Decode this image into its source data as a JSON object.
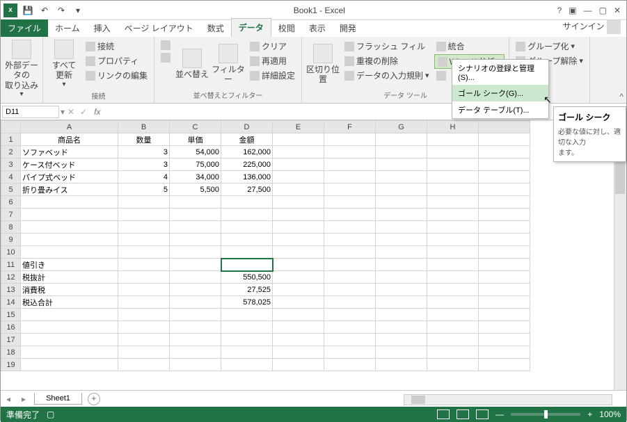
{
  "app": {
    "title": "Book1 - Excel",
    "signin": "サインイン"
  },
  "tabs": {
    "file": "ファイル",
    "home": "ホーム",
    "insert": "挿入",
    "pagelayout": "ページ レイアウト",
    "formulas": "数式",
    "data": "データ",
    "review": "校閲",
    "view": "表示",
    "dev": "開発"
  },
  "ribbon": {
    "ext_data": "外部データの\n取り込み",
    "refresh": "すべて\n更新",
    "conn_label": "接続",
    "conn": "接続",
    "prop": "プロパティ",
    "editlink": "リンクの編集",
    "sortasc": "A→Z",
    "sortdesc": "Z→A",
    "sort": "並べ替え",
    "filter": "フィルター",
    "clear": "クリア",
    "reapply": "再適用",
    "advanced": "詳細設定",
    "sortfilter_label": "並べ替えとフィルター",
    "t2c": "区切り位置",
    "flash": "フラッシュ フィル",
    "dedup": "重複の削除",
    "dataval": "データの入力規則",
    "consol": "統合",
    "whatif": "What-If 分析",
    "datatools_label": "データ ツール",
    "group": "グループ化",
    "ungroup": "グループ解除"
  },
  "whatif_menu": {
    "scenario": "シナリオの登録と管理(S)...",
    "goal": "ゴール シーク(G)...",
    "table": "データ テーブル(T)..."
  },
  "tooltip": {
    "title": "ゴール シーク",
    "body": "必要な値に対し、適切な入力\nます。"
  },
  "namebox": "D11",
  "cols": [
    "A",
    "B",
    "C",
    "D",
    "E",
    "F",
    "G",
    "H"
  ],
  "rows": [
    {
      "r": 1,
      "a": "商品名",
      "b": "数量",
      "c": "単価",
      "d": "金額",
      "hdr": true
    },
    {
      "r": 2,
      "a": "ソファベッド",
      "b": "3",
      "c": "54,000",
      "d": "162,000"
    },
    {
      "r": 3,
      "a": "ケース付ベッド",
      "b": "3",
      "c": "75,000",
      "d": "225,000"
    },
    {
      "r": 4,
      "a": "パイプ式ベッド",
      "b": "4",
      "c": "34,000",
      "d": "136,000"
    },
    {
      "r": 5,
      "a": "折り畳みイス",
      "b": "5",
      "c": "5,500",
      "d": "27,500"
    },
    {
      "r": 6,
      "a": "",
      "b": "",
      "c": "",
      "d": ""
    },
    {
      "r": 7,
      "a": "",
      "b": "",
      "c": "",
      "d": ""
    },
    {
      "r": 8,
      "a": "",
      "b": "",
      "c": "",
      "d": ""
    },
    {
      "r": 9,
      "a": "",
      "b": "",
      "c": "",
      "d": ""
    },
    {
      "r": 10,
      "a": "",
      "b": "",
      "c": "",
      "d": ""
    },
    {
      "r": 11,
      "a": "値引き",
      "b": "",
      "c": "",
      "d": ""
    },
    {
      "r": 12,
      "a": "税抜計",
      "b": "",
      "c": "",
      "d": "550,500"
    },
    {
      "r": 13,
      "a": "消費税",
      "b": "",
      "c": "",
      "d": "27,525"
    },
    {
      "r": 14,
      "a": "税込合計",
      "b": "",
      "c": "",
      "d": "578,025"
    },
    {
      "r": 15,
      "a": "",
      "b": "",
      "c": "",
      "d": ""
    },
    {
      "r": 16,
      "a": "",
      "b": "",
      "c": "",
      "d": ""
    },
    {
      "r": 17,
      "a": "",
      "b": "",
      "c": "",
      "d": ""
    },
    {
      "r": 18,
      "a": "",
      "b": "",
      "c": "",
      "d": ""
    },
    {
      "r": 19,
      "a": "",
      "b": "",
      "c": "",
      "d": ""
    }
  ],
  "sheet": "Sheet1",
  "status": {
    "ready": "準備完了",
    "zoom": "100%"
  }
}
